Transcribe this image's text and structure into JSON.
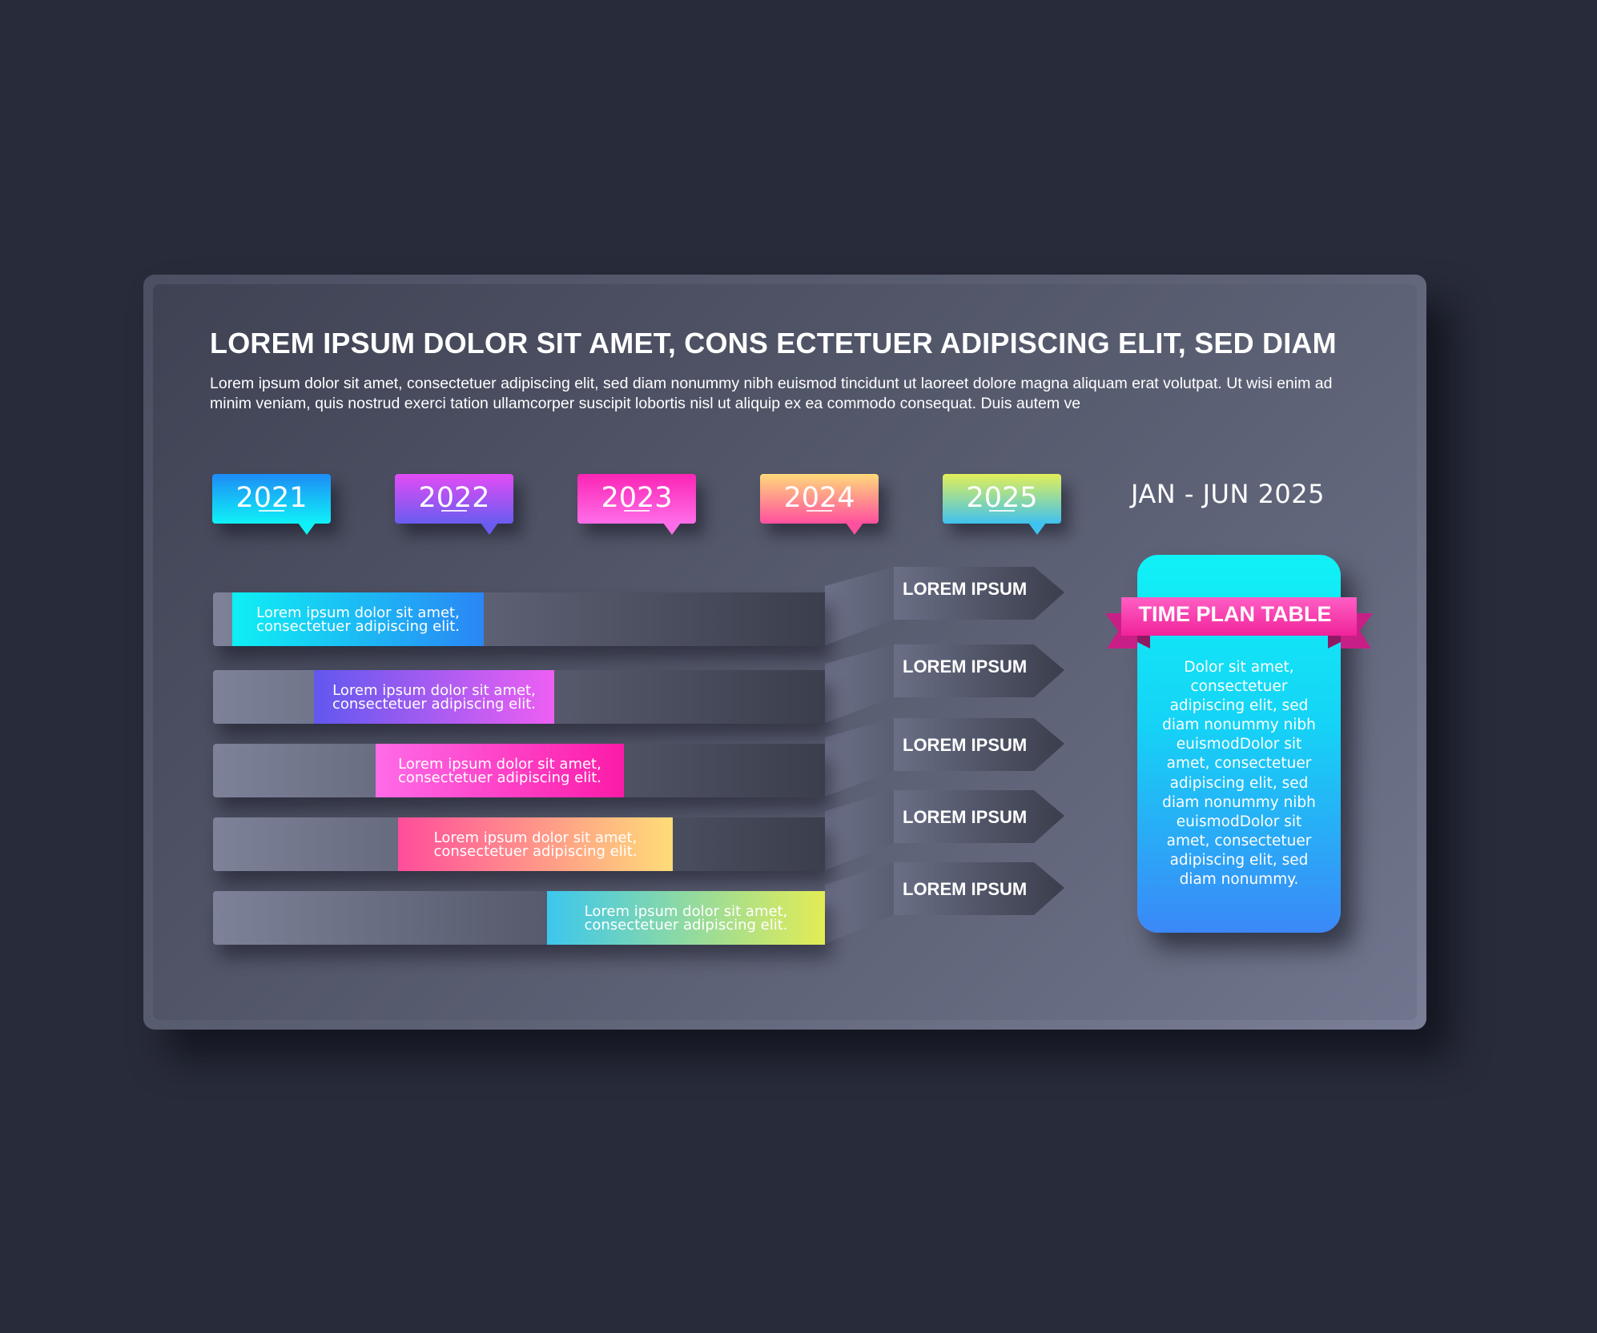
{
  "header": {
    "title": "LOREM IPSUM DOLOR SIT AMET, CONS ECTETUER ADIPISCING ELIT, SED DIAM",
    "subtitle": "Lorem ipsum dolor sit amet, consectetuer adipiscing elit, sed diam nonummy nibh euismod tincidunt ut laoreet dolore magna aliquam erat volutpat. Ut wisi enim ad minim veniam, quis nostrud exerci tation ullamcorper suscipit lobortis nisl ut aliquip ex ea commodo consequat. Duis autem ve"
  },
  "years": [
    {
      "label": "2021",
      "gradient": [
        "#1e8cf7",
        "#0ff2f7"
      ]
    },
    {
      "label": "2022",
      "gradient": [
        "#e24cf5",
        "#6a5cf0"
      ]
    },
    {
      "label": "2023",
      "gradient": [
        "#fb25b5",
        "#ff6ee9"
      ]
    },
    {
      "label": "2024",
      "gradient": [
        "#ffd97a",
        "#ff4f9f"
      ]
    },
    {
      "label": "2025",
      "gradient": [
        "#e3ef58",
        "#3fc2ef"
      ]
    }
  ],
  "period": "JAN - JUN  2025",
  "rows": [
    {
      "line1": "Lorem ipsum dolor sit amet,",
      "line2": "consectetuer adipiscing elit.",
      "label": "LOREM IPSUM",
      "colors": [
        "#0ef0f4",
        "#2a86f5"
      ]
    },
    {
      "line1": "Lorem ipsum dolor sit amet,",
      "line2": "consectetuer adipiscing elit.",
      "label": "LOREM IPSUM",
      "colors": [
        "#6158ef",
        "#ee5ff3"
      ]
    },
    {
      "line1": "Lorem ipsum dolor sit amet,",
      "line2": "consectetuer adipiscing elit.",
      "label": "LOREM IPSUM",
      "colors": [
        "#ff6be8",
        "#fc1ba8"
      ]
    },
    {
      "line1": "Lorem ipsum dolor sit amet,",
      "line2": "consectetuer adipiscing elit.",
      "label": "LOREM IPSUM",
      "colors": [
        "#ff4d9b",
        "#ffdc78"
      ]
    },
    {
      "line1": "Lorem ipsum dolor sit amet,",
      "line2": "consectetuer adipiscing elit.",
      "label": "LOREM IPSUM",
      "colors": [
        "#3cc7ee",
        "#e3ec55"
      ]
    }
  ],
  "panel": {
    "title": "TIME PLAN TABLE",
    "body": "Dolor sit amet, consectetuer adipiscing elit, sed diam nonummy nibh euismodDolor sit amet, consectetuer adipiscing elit, sed diam nonummy nibh euismodDolor sit amet, consectetuer adipiscing elit, sed diam nonummy.",
    "ribbon_color": "#ff3fae"
  },
  "colors": {
    "background": "#282b3a"
  }
}
